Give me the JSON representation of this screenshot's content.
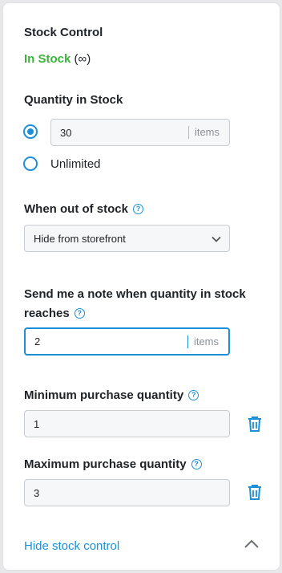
{
  "stock": {
    "title": "Stock Control",
    "status_label": "In Stock",
    "status_suffix": "(∞)",
    "status_color": "#3bb33b"
  },
  "quantity": {
    "label": "Quantity in Stock",
    "selected_option": "quantity",
    "value": "30",
    "unit": "items",
    "unlimited_label": "Unlimited"
  },
  "out_of_stock": {
    "label": "When out of stock",
    "selected": "Hide from storefront"
  },
  "notify": {
    "label_line1": "Send me a note when quantity in stock",
    "label_line2": "reaches",
    "value": "2",
    "unit": "items"
  },
  "min_purchase": {
    "label": "Minimum purchase quantity",
    "value": "1"
  },
  "max_purchase": {
    "label": "Maximum purchase quantity",
    "value": "3"
  },
  "footer": {
    "toggle_label": "Hide stock control"
  },
  "colors": {
    "accent": "#1d8fd6",
    "success": "#3bb33b"
  },
  "icons": {
    "help": "help-circle-icon",
    "delete": "trash-icon",
    "collapse": "chevron-up-icon",
    "dropdown": "chevron-down-icon"
  }
}
